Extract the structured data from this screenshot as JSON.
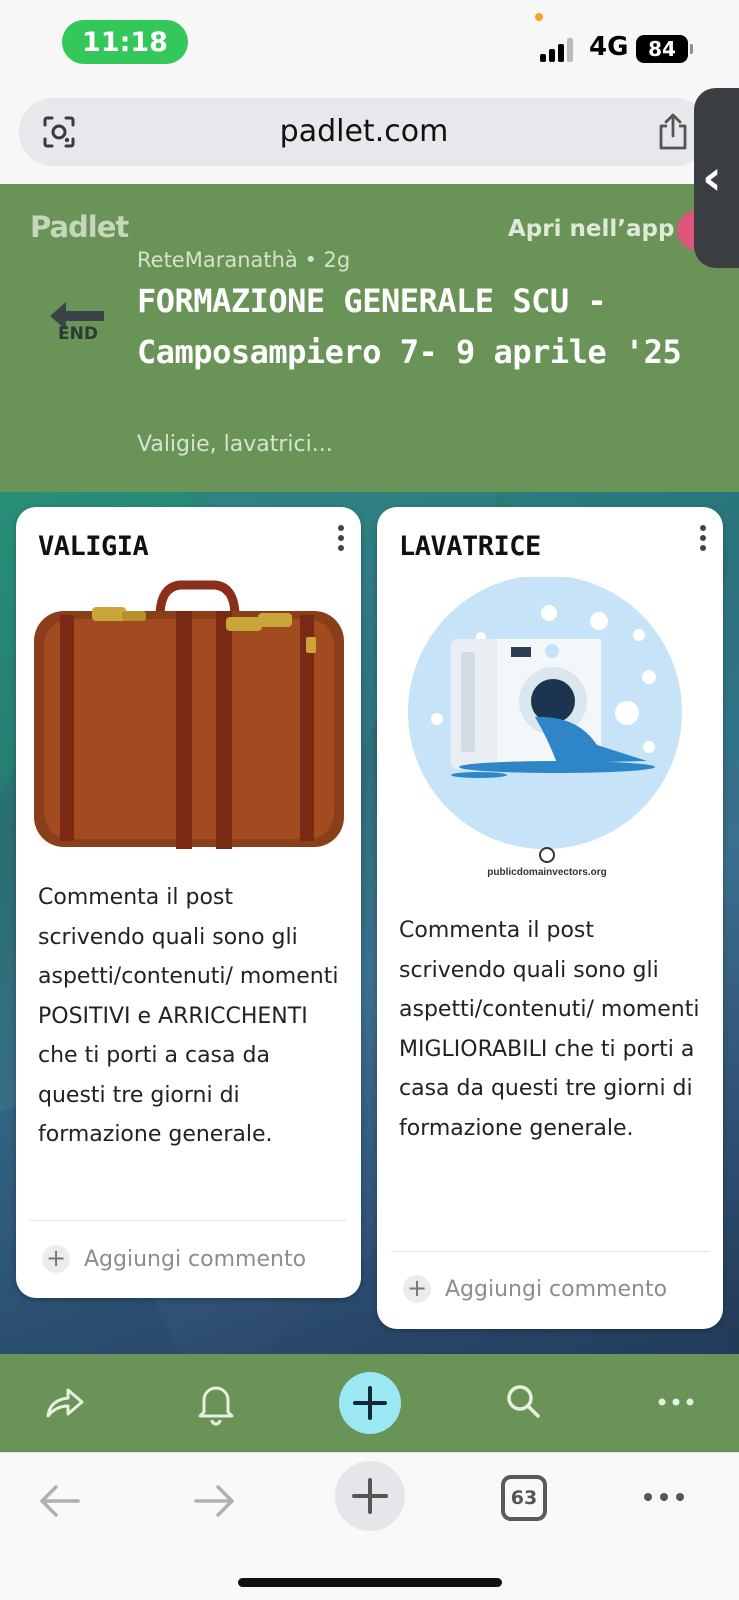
{
  "status": {
    "time": "11:18",
    "network": "4G",
    "battery": "84",
    "colors": {
      "time_pill": "#34c759"
    }
  },
  "browser": {
    "url": "padlet.com",
    "tabs_count": "63",
    "icons": [
      "camera-lens-icon",
      "share-icon",
      "back-arrow-icon",
      "forward-arrow-icon",
      "new-tab-plus-icon",
      "more-dots-icon"
    ]
  },
  "padlet": {
    "logo": "Padlet",
    "open_in_app": "Apri nell’app",
    "end_label": "END",
    "author_line": "ReteMaranathà • 2g",
    "title": "FORMAZIONE GENERALE SCU - Camposampiero 7- 9 aprile '25",
    "description": "Valigie, lavatrici...",
    "colors": {
      "header": "#6a9358",
      "add_button": "#9ce8f2"
    }
  },
  "posts": [
    {
      "title": "VALIGIA",
      "image": "suitcase-image",
      "body": "Commenta il post scrivendo quali sono gli aspetti/contenuti/ momenti POSITIVI e ARRICCHENTI che ti porti a casa da questi tre giorni di formazione generale.",
      "comment_placeholder": "Aggiungi commento"
    },
    {
      "title": "LAVATRICE",
      "image": "washing-machine-image",
      "image_credit": "publicdomainvectors.org",
      "body": "Commenta il post scrivendo quali sono gli aspetti/contenuti/ momenti MIGLIORABILI che ti porti a casa da questi tre giorni di formazione generale.",
      "comment_placeholder": "Aggiungi commento"
    }
  ],
  "padlet_toolbar": {
    "icons": [
      "share-arrow-icon",
      "bell-icon",
      "add-post-plus-icon",
      "search-icon",
      "more-dots-icon"
    ]
  }
}
